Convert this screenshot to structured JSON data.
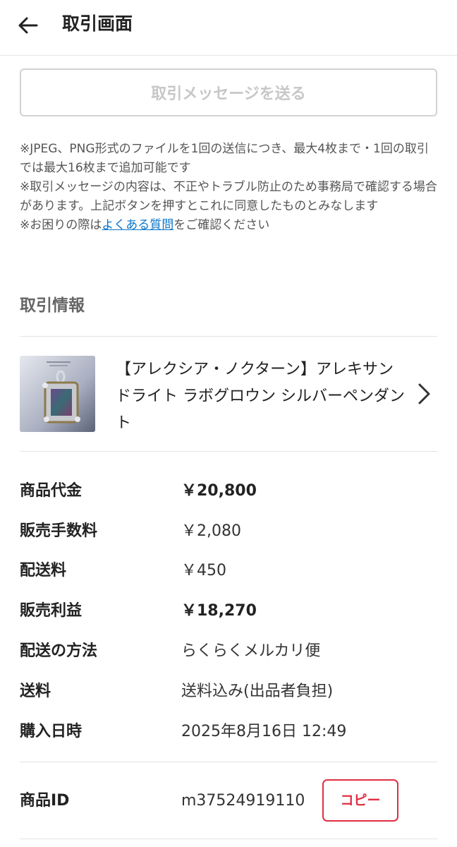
{
  "header": {
    "title": "取引画面"
  },
  "send_button": {
    "label": "取引メッセージを送る"
  },
  "notes": {
    "line1": "※JPEG、PNG形式のファイルを1回の送信につき、最大4枚まで・1回の取引では最大16枚まで追加可能です",
    "line2": "※取引メッセージの内容は、不正やトラブル防止のため事務局で確認する場合があります。上記ボタンを押すとこれに同意したものとみなします",
    "line3_prefix": "※お困りの際は",
    "line3_link": "よくある質問",
    "line3_suffix": "をご確認ください"
  },
  "trade_info": {
    "title": "取引情報",
    "product_name": "【アレクシア・ノクターン】アレキサンドライト ラボグロウン シルバーペンダント"
  },
  "details": [
    {
      "label": "商品代金",
      "value": "￥20,800"
    },
    {
      "label": "販売手数料",
      "value": "￥2,080"
    },
    {
      "label": "配送料",
      "value": "￥450"
    },
    {
      "label": "販売利益",
      "value": "￥18,270"
    },
    {
      "label": "配送の方法",
      "value": "らくらくメルカリ便"
    },
    {
      "label": "送料",
      "value": "送料込み(出品者負担)"
    },
    {
      "label": "購入日時",
      "value": "2025年8月16日 12:49"
    }
  ],
  "product_id": {
    "label": "商品ID",
    "value": "m37524919110",
    "copy_label": "コピー"
  },
  "colors": {
    "accent_red": "#e02f43",
    "link_blue": "#0b75c9"
  }
}
